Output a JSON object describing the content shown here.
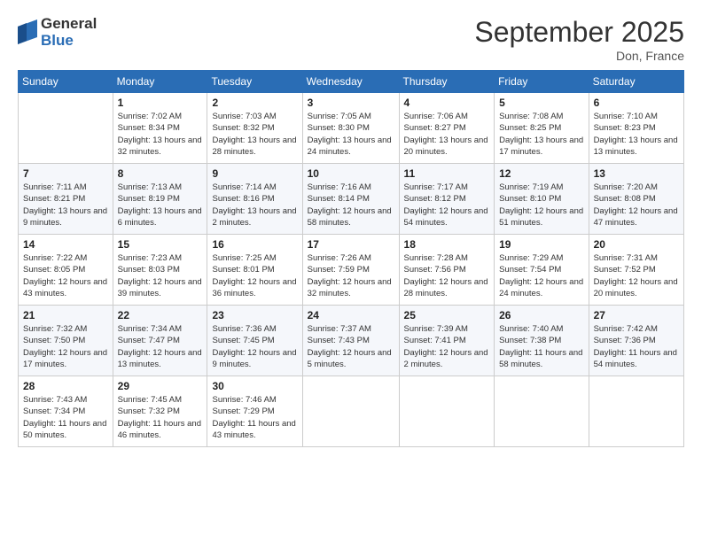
{
  "logo": {
    "general": "General",
    "blue": "Blue"
  },
  "header": {
    "month": "September 2025",
    "location": "Don, France"
  },
  "weekdays": [
    "Sunday",
    "Monday",
    "Tuesday",
    "Wednesday",
    "Thursday",
    "Friday",
    "Saturday"
  ],
  "weeks": [
    [
      {
        "day": "",
        "sunrise": "",
        "sunset": "",
        "daylight": ""
      },
      {
        "day": "1",
        "sunrise": "Sunrise: 7:02 AM",
        "sunset": "Sunset: 8:34 PM",
        "daylight": "Daylight: 13 hours and 32 minutes."
      },
      {
        "day": "2",
        "sunrise": "Sunrise: 7:03 AM",
        "sunset": "Sunset: 8:32 PM",
        "daylight": "Daylight: 13 hours and 28 minutes."
      },
      {
        "day": "3",
        "sunrise": "Sunrise: 7:05 AM",
        "sunset": "Sunset: 8:30 PM",
        "daylight": "Daylight: 13 hours and 24 minutes."
      },
      {
        "day": "4",
        "sunrise": "Sunrise: 7:06 AM",
        "sunset": "Sunset: 8:27 PM",
        "daylight": "Daylight: 13 hours and 20 minutes."
      },
      {
        "day": "5",
        "sunrise": "Sunrise: 7:08 AM",
        "sunset": "Sunset: 8:25 PM",
        "daylight": "Daylight: 13 hours and 17 minutes."
      },
      {
        "day": "6",
        "sunrise": "Sunrise: 7:10 AM",
        "sunset": "Sunset: 8:23 PM",
        "daylight": "Daylight: 13 hours and 13 minutes."
      }
    ],
    [
      {
        "day": "7",
        "sunrise": "Sunrise: 7:11 AM",
        "sunset": "Sunset: 8:21 PM",
        "daylight": "Daylight: 13 hours and 9 minutes."
      },
      {
        "day": "8",
        "sunrise": "Sunrise: 7:13 AM",
        "sunset": "Sunset: 8:19 PM",
        "daylight": "Daylight: 13 hours and 6 minutes."
      },
      {
        "day": "9",
        "sunrise": "Sunrise: 7:14 AM",
        "sunset": "Sunset: 8:16 PM",
        "daylight": "Daylight: 13 hours and 2 minutes."
      },
      {
        "day": "10",
        "sunrise": "Sunrise: 7:16 AM",
        "sunset": "Sunset: 8:14 PM",
        "daylight": "Daylight: 12 hours and 58 minutes."
      },
      {
        "day": "11",
        "sunrise": "Sunrise: 7:17 AM",
        "sunset": "Sunset: 8:12 PM",
        "daylight": "Daylight: 12 hours and 54 minutes."
      },
      {
        "day": "12",
        "sunrise": "Sunrise: 7:19 AM",
        "sunset": "Sunset: 8:10 PM",
        "daylight": "Daylight: 12 hours and 51 minutes."
      },
      {
        "day": "13",
        "sunrise": "Sunrise: 7:20 AM",
        "sunset": "Sunset: 8:08 PM",
        "daylight": "Daylight: 12 hours and 47 minutes."
      }
    ],
    [
      {
        "day": "14",
        "sunrise": "Sunrise: 7:22 AM",
        "sunset": "Sunset: 8:05 PM",
        "daylight": "Daylight: 12 hours and 43 minutes."
      },
      {
        "day": "15",
        "sunrise": "Sunrise: 7:23 AM",
        "sunset": "Sunset: 8:03 PM",
        "daylight": "Daylight: 12 hours and 39 minutes."
      },
      {
        "day": "16",
        "sunrise": "Sunrise: 7:25 AM",
        "sunset": "Sunset: 8:01 PM",
        "daylight": "Daylight: 12 hours and 36 minutes."
      },
      {
        "day": "17",
        "sunrise": "Sunrise: 7:26 AM",
        "sunset": "Sunset: 7:59 PM",
        "daylight": "Daylight: 12 hours and 32 minutes."
      },
      {
        "day": "18",
        "sunrise": "Sunrise: 7:28 AM",
        "sunset": "Sunset: 7:56 PM",
        "daylight": "Daylight: 12 hours and 28 minutes."
      },
      {
        "day": "19",
        "sunrise": "Sunrise: 7:29 AM",
        "sunset": "Sunset: 7:54 PM",
        "daylight": "Daylight: 12 hours and 24 minutes."
      },
      {
        "day": "20",
        "sunrise": "Sunrise: 7:31 AM",
        "sunset": "Sunset: 7:52 PM",
        "daylight": "Daylight: 12 hours and 20 minutes."
      }
    ],
    [
      {
        "day": "21",
        "sunrise": "Sunrise: 7:32 AM",
        "sunset": "Sunset: 7:50 PM",
        "daylight": "Daylight: 12 hours and 17 minutes."
      },
      {
        "day": "22",
        "sunrise": "Sunrise: 7:34 AM",
        "sunset": "Sunset: 7:47 PM",
        "daylight": "Daylight: 12 hours and 13 minutes."
      },
      {
        "day": "23",
        "sunrise": "Sunrise: 7:36 AM",
        "sunset": "Sunset: 7:45 PM",
        "daylight": "Daylight: 12 hours and 9 minutes."
      },
      {
        "day": "24",
        "sunrise": "Sunrise: 7:37 AM",
        "sunset": "Sunset: 7:43 PM",
        "daylight": "Daylight: 12 hours and 5 minutes."
      },
      {
        "day": "25",
        "sunrise": "Sunrise: 7:39 AM",
        "sunset": "Sunset: 7:41 PM",
        "daylight": "Daylight: 12 hours and 2 minutes."
      },
      {
        "day": "26",
        "sunrise": "Sunrise: 7:40 AM",
        "sunset": "Sunset: 7:38 PM",
        "daylight": "Daylight: 11 hours and 58 minutes."
      },
      {
        "day": "27",
        "sunrise": "Sunrise: 7:42 AM",
        "sunset": "Sunset: 7:36 PM",
        "daylight": "Daylight: 11 hours and 54 minutes."
      }
    ],
    [
      {
        "day": "28",
        "sunrise": "Sunrise: 7:43 AM",
        "sunset": "Sunset: 7:34 PM",
        "daylight": "Daylight: 11 hours and 50 minutes."
      },
      {
        "day": "29",
        "sunrise": "Sunrise: 7:45 AM",
        "sunset": "Sunset: 7:32 PM",
        "daylight": "Daylight: 11 hours and 46 minutes."
      },
      {
        "day": "30",
        "sunrise": "Sunrise: 7:46 AM",
        "sunset": "Sunset: 7:29 PM",
        "daylight": "Daylight: 11 hours and 43 minutes."
      },
      {
        "day": "",
        "sunrise": "",
        "sunset": "",
        "daylight": ""
      },
      {
        "day": "",
        "sunrise": "",
        "sunset": "",
        "daylight": ""
      },
      {
        "day": "",
        "sunrise": "",
        "sunset": "",
        "daylight": ""
      },
      {
        "day": "",
        "sunrise": "",
        "sunset": "",
        "daylight": ""
      }
    ]
  ]
}
